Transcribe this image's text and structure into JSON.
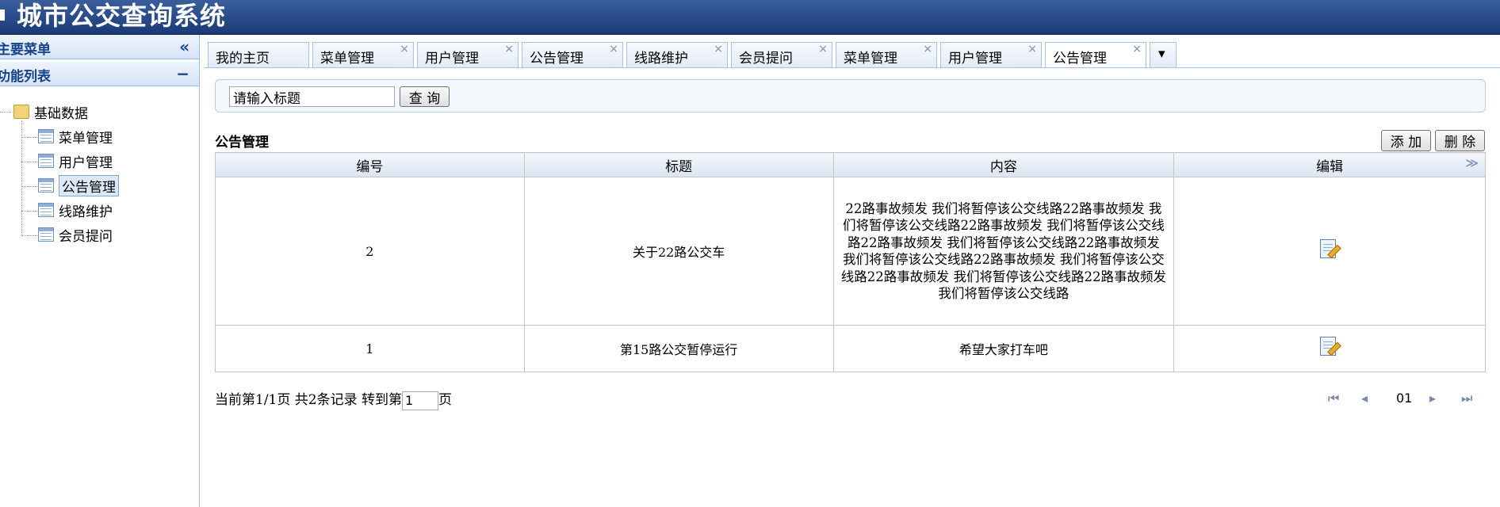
{
  "app": {
    "title": "城市公交查询系统"
  },
  "left": {
    "main_menu": "主要菜单",
    "collapse_glyph": "«",
    "func_list": "功能列表",
    "func_glyph": "−",
    "root": "基础数据",
    "items": [
      "菜单管理",
      "用户管理",
      "公告管理",
      "线路维护",
      "会员提问"
    ]
  },
  "tabs": [
    {
      "label": "我的主页",
      "closable": false
    },
    {
      "label": "菜单管理",
      "closable": true
    },
    {
      "label": "用户管理",
      "closable": true
    },
    {
      "label": "公告管理",
      "closable": true
    },
    {
      "label": "线路维护",
      "closable": true
    },
    {
      "label": "会员提问",
      "closable": true
    },
    {
      "label": "菜单管理",
      "closable": true
    },
    {
      "label": "用户管理",
      "closable": true
    },
    {
      "label": "公告管理",
      "closable": true,
      "active": true
    }
  ],
  "tab_close_glyph": "×",
  "tab_more_glyph": "▾",
  "search": {
    "value": "请输入标题",
    "button": "查 询"
  },
  "grid": {
    "title": "公告管理",
    "add_button": "添 加",
    "delete_button": "删 除",
    "columns": [
      "编号",
      "标题",
      "内容",
      "编辑"
    ],
    "expand_glyph": "≫",
    "rows": [
      {
        "id": "2",
        "title": "关于22路公交车",
        "content": "22路事故频发 我们将暂停该公交线路22路事故频发 我们将暂停该公交线路22路事故频发 我们将暂停该公交线路22路事故频发 我们将暂停该公交线路22路事故频发 我们将暂停该公交线路22路事故频发 我们将暂停该公交线路22路事故频发 我们将暂停该公交线路22路事故频发 我们将暂停该公交线路"
      },
      {
        "id": "1",
        "title": "第15路公交暂停运行",
        "content": "希望大家打车吧"
      }
    ]
  },
  "pager": {
    "info": "当前第1/1页 共2条记录 转到第",
    "page_value": "1",
    "suffix": "页",
    "current": "01",
    "first": "⏮",
    "prev": "◂",
    "next": "▸",
    "last": "⏭"
  }
}
